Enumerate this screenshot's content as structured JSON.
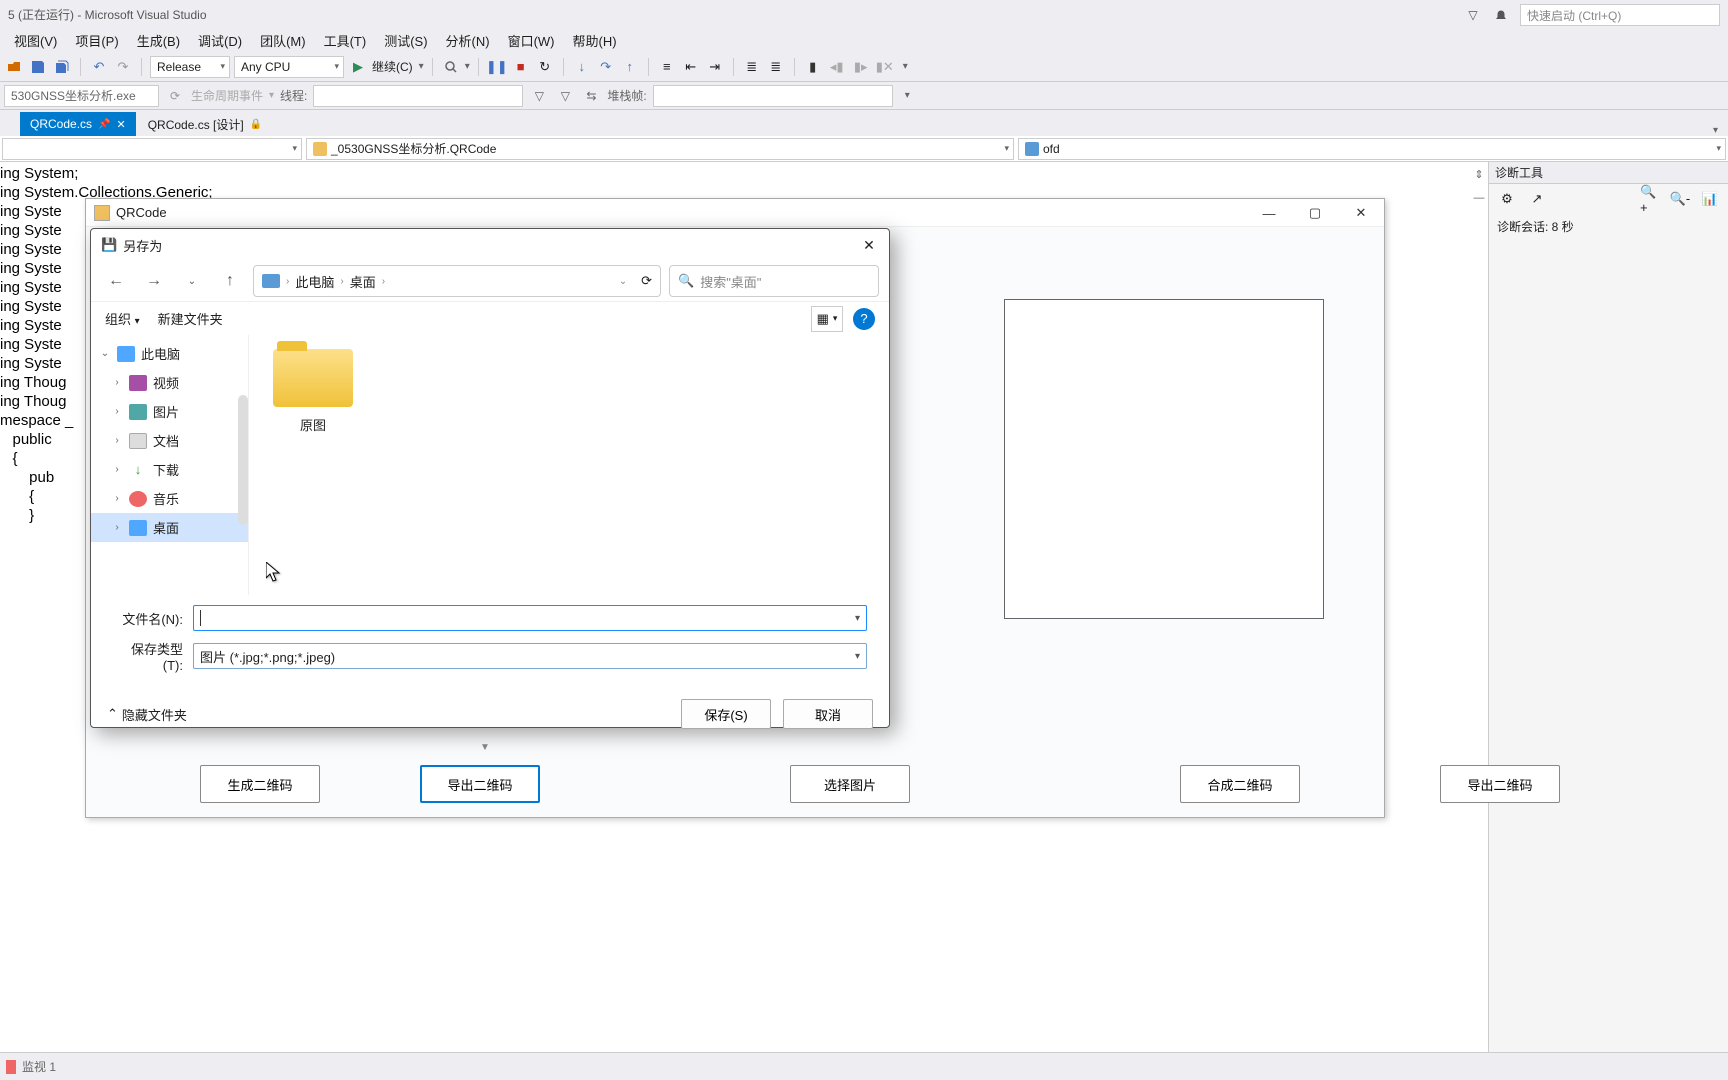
{
  "title_bar": {
    "text": "5 (正在运行) - Microsoft Visual Studio",
    "quick_launch_placeholder": "快速启动 (Ctrl+Q)"
  },
  "menu": {
    "items": [
      "视图(V)",
      "项目(P)",
      "生成(B)",
      "调试(D)",
      "团队(M)",
      "工具(T)",
      "测试(S)",
      "分析(N)",
      "窗口(W)",
      "帮助(H)"
    ]
  },
  "toolbar1": {
    "config": "Release",
    "platform": "Any CPU",
    "continue": "继续(C)"
  },
  "toolbar2": {
    "process": "530GNSS坐标分析.exe",
    "lifecycle": "生命周期事件",
    "thread_label": "线程:",
    "stackframe_label": "堆栈帧:"
  },
  "tabs": {
    "items": [
      {
        "label": "QRCode.cs",
        "active": true
      },
      {
        "label": "QRCode.cs [设计]",
        "active": false
      }
    ]
  },
  "nav_combos": {
    "ns": "_0530GNSS坐标分析.QRCode",
    "member": "ofd"
  },
  "code_lines": [
    "ing System;",
    "ing System.Collections.Generic;",
    "ing Syste",
    "ing Syste",
    "ing Syste",
    "ing Syste",
    "ing Syste",
    "ing Syste",
    "ing Syste",
    "ing Syste",
    "ing Syste",
    "ing Thoug",
    "ing Thoug",
    "",
    "mespace _",
    "",
    "   public",
    "   {",
    "       pub",
    "       {",
    "",
    "       }"
  ],
  "diag": {
    "title": "诊断工具",
    "session": "诊断会话: 8 秒"
  },
  "qrcode_window": {
    "title": "QRCode"
  },
  "saveas": {
    "title": "另存为",
    "breadcrumb": [
      "此电脑",
      "桌面"
    ],
    "search_placeholder": "搜索\"桌面\"",
    "organize": "组织",
    "new_folder": "新建文件夹",
    "tree": [
      {
        "label": "此电脑",
        "level": 0,
        "expanded": true,
        "icon": "pc"
      },
      {
        "label": "视频",
        "level": 1,
        "icon": "video"
      },
      {
        "label": "图片",
        "level": 1,
        "icon": "pic"
      },
      {
        "label": "文档",
        "level": 1,
        "icon": "doc"
      },
      {
        "label": "下载",
        "level": 1,
        "icon": "down"
      },
      {
        "label": "音乐",
        "level": 1,
        "icon": "music"
      },
      {
        "label": "桌面",
        "level": 1,
        "icon": "desk",
        "selected": true
      }
    ],
    "files": [
      {
        "name": "原图",
        "type": "folder"
      }
    ],
    "filename_label": "文件名(N):",
    "filetype_label": "保存类型(T):",
    "filetype_value": "图片 (*.jpg;*.png;*.jpeg)",
    "hide_folders": "隐藏文件夹",
    "save_btn": "保存(S)",
    "cancel_btn": "取消"
  },
  "app_buttons": {
    "gen_qr": "生成二维码",
    "export_qr": "导出二维码",
    "select_img": "选择图片",
    "compose_qr": "合成二维码",
    "export_qr2": "导出二维码"
  },
  "bottom_panel": {
    "watch": "监视 1"
  }
}
